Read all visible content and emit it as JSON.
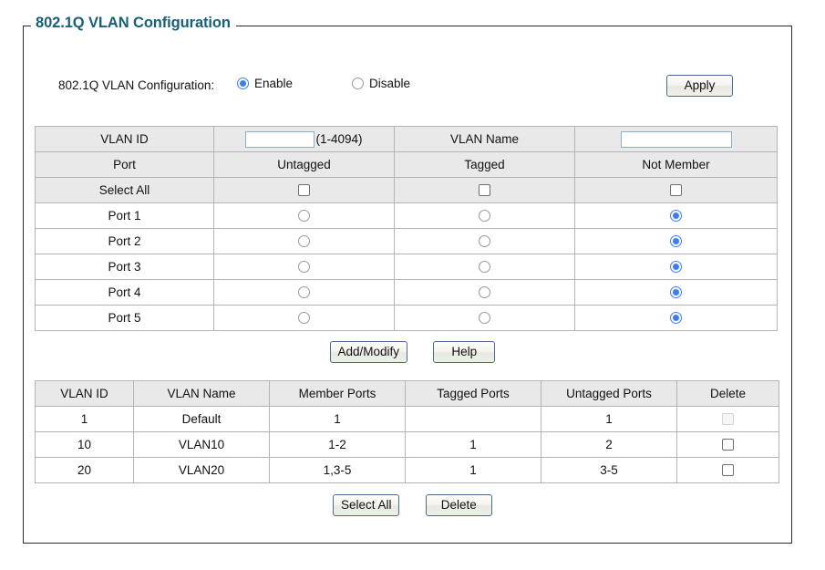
{
  "page": {
    "legend": "802.1Q VLAN Configuration",
    "accent_color": "#186079",
    "radio_on_color": "#3b7ef5",
    "header_bg": "#e9e9e9",
    "border_color": "#b4b4b4"
  },
  "config": {
    "label": "802.1Q VLAN Configuration:",
    "options": [
      {
        "label": "Enable",
        "selected": true
      },
      {
        "label": "Disable",
        "selected": false
      }
    ],
    "apply_label": "Apply"
  },
  "entry_form": {
    "vlan_id_label": "VLAN ID",
    "vlan_id_value": "",
    "vlan_id_hint": "(1-4094)",
    "vlan_name_label": "VLAN Name",
    "vlan_name_value": "",
    "columns": [
      "Port",
      "Untagged",
      "Tagged",
      "Not Member"
    ],
    "select_all_label": "Select All",
    "select_all_checked": [
      false,
      false,
      false
    ],
    "ports": [
      {
        "label": "Port 1",
        "membership": "not_member"
      },
      {
        "label": "Port 2",
        "membership": "not_member"
      },
      {
        "label": "Port 3",
        "membership": "not_member"
      },
      {
        "label": "Port 4",
        "membership": "not_member"
      },
      {
        "label": "Port 5",
        "membership": "not_member"
      }
    ],
    "add_modify_label": "Add/Modify",
    "help_label": "Help"
  },
  "vlan_table": {
    "columns": [
      "VLAN ID",
      "VLAN Name",
      "Member Ports",
      "Tagged Ports",
      "Untagged Ports",
      "Delete"
    ],
    "rows": [
      {
        "vlan_id": "1",
        "vlan_name": "Default",
        "member_ports": "1",
        "tagged_ports": "",
        "untagged_ports": "1",
        "delete_checked": false,
        "delete_disabled": true
      },
      {
        "vlan_id": "10",
        "vlan_name": "VLAN10",
        "member_ports": "1-2",
        "tagged_ports": "1",
        "untagged_ports": "2",
        "delete_checked": false,
        "delete_disabled": false
      },
      {
        "vlan_id": "20",
        "vlan_name": "VLAN20",
        "member_ports": "1,3-5",
        "tagged_ports": "1",
        "untagged_ports": "3-5",
        "delete_checked": false,
        "delete_disabled": false
      }
    ],
    "select_all_label": "Select All",
    "delete_label": "Delete"
  }
}
